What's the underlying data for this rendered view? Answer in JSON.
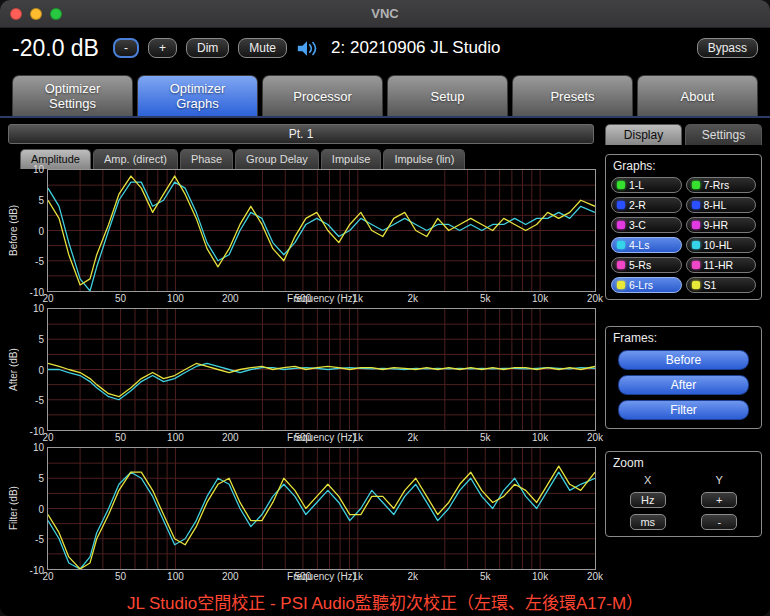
{
  "window": {
    "title": "VNC"
  },
  "toolbar": {
    "volume": "-20.0 dB",
    "volume_down": "-",
    "volume_up": "+",
    "dim": "Dim",
    "mute": "Mute",
    "source": "2: 20210906 JL Studio",
    "bypass": "Bypass"
  },
  "main_tabs": [
    {
      "label": "Optimizer\nSettings",
      "selected": false
    },
    {
      "label": "Optimizer\nGraphs",
      "selected": true
    },
    {
      "label": "Processor",
      "selected": false
    },
    {
      "label": "Setup",
      "selected": false
    },
    {
      "label": "Presets",
      "selected": false
    },
    {
      "label": "About",
      "selected": false
    }
  ],
  "graphs_panel": {
    "header": "Pt. 1",
    "sub_tabs": [
      {
        "label": "Amplitude",
        "selected": true
      },
      {
        "label": "Amp. (direct)",
        "selected": false
      },
      {
        "label": "Phase",
        "selected": false
      },
      {
        "label": "Group Delay",
        "selected": false
      },
      {
        "label": "Impulse",
        "selected": false
      },
      {
        "label": "Impulse (lin)",
        "selected": false
      }
    ]
  },
  "sidebar": {
    "tabs": [
      {
        "label": "Display",
        "selected": true
      },
      {
        "label": "Settings",
        "selected": false
      }
    ],
    "graphs_group_label": "Graphs:",
    "channels": [
      {
        "label": "1-L",
        "led": "#35e02f",
        "selected": false
      },
      {
        "label": "2-R",
        "led": "#2b50ff",
        "selected": false
      },
      {
        "label": "3-C",
        "led": "#e23ae2",
        "selected": false
      },
      {
        "label": "4-Ls",
        "led": "#35d4e8",
        "selected": true
      },
      {
        "label": "5-Rs",
        "led": "#f046c8",
        "selected": false
      },
      {
        "label": "6-Lrs",
        "led": "#e8e838",
        "selected": true
      },
      {
        "label": "7-Rrs",
        "led": "#35e02f",
        "selected": false
      },
      {
        "label": "8-HL",
        "led": "#2b50ff",
        "selected": false
      },
      {
        "label": "9-HR",
        "led": "#e23ae2",
        "selected": false
      },
      {
        "label": "10-HL",
        "led": "#35d4e8",
        "selected": false
      },
      {
        "label": "11-HR",
        "led": "#f046c8",
        "selected": false
      },
      {
        "label": "S1",
        "led": "#e8e838",
        "selected": false
      }
    ],
    "frames_group_label": "Frames:",
    "frame_buttons": [
      "Before",
      "After",
      "Filter"
    ],
    "zoom_group_label": "Zoom",
    "zoom_x_label": "X",
    "zoom_y_label": "Y",
    "zoom_x_buttons": [
      "Hz",
      "ms"
    ],
    "zoom_y_buttons": [
      "+",
      "-"
    ]
  },
  "status_bar": {
    "text": "JL Studio空間校正 - PSI Audio監聽初次校正（左環、左後環A17-M）"
  },
  "colors": {
    "accent": "#2f62d9",
    "trace_cyan": "#3fd0e0",
    "trace_yellow": "#e6e23c",
    "grid": "#4d1f1f",
    "status_text": "#ff4633"
  },
  "chart_data": [
    {
      "type": "line",
      "ylabel": "Before (dB)",
      "xlabel": "Frequency (Hz)",
      "xscale": "log",
      "xlim": [
        20,
        20000
      ],
      "ylim": [
        -10,
        10
      ],
      "x_ticks": [
        {
          "value": 20,
          "label": "20"
        },
        {
          "value": 50,
          "label": "50"
        },
        {
          "value": 100,
          "label": "100"
        },
        {
          "value": 200,
          "label": "200"
        },
        {
          "value": 500,
          "label": "500"
        },
        {
          "value": 1000,
          "label": "1k"
        },
        {
          "value": 2000,
          "label": "2k"
        },
        {
          "value": 5000,
          "label": "5k"
        },
        {
          "value": 10000,
          "label": "10k"
        },
        {
          "value": 20000,
          "label": "20k"
        }
      ],
      "y_ticks": [
        10,
        5,
        0,
        -5,
        -10
      ],
      "x_hz": [
        20,
        23,
        26,
        30,
        34,
        37,
        43,
        49,
        57,
        65,
        75,
        86,
        99,
        113,
        130,
        149,
        171,
        197,
        226,
        259,
        298,
        342,
        393,
        452,
        519,
        596,
        685,
        787,
        904,
        1039,
        1193,
        1371,
        1575,
        1810,
        2079,
        2389,
        2745,
        3154,
        3624,
        4164,
        4784,
        5497,
        6316,
        7257,
        8338,
        9580,
        11007,
        12647,
        14531,
        16697,
        20000
      ],
      "series": [
        {
          "name": "4-Ls",
          "color_key": "trace_cyan",
          "db": [
            7,
            4,
            -2,
            -8,
            -10,
            -6,
            0,
            5,
            8,
            8,
            4,
            5,
            8,
            7,
            3,
            -2,
            -5,
            -4,
            0,
            3,
            2,
            -2,
            -4,
            -2,
            1,
            2,
            1,
            -1,
            0,
            2,
            1,
            0,
            1,
            2,
            1,
            0,
            1,
            1,
            0,
            1,
            0,
            1,
            1,
            2,
            1,
            2,
            2,
            3,
            2,
            4,
            3
          ]
        },
        {
          "name": "6-Lrs",
          "color_key": "trace_yellow",
          "db": [
            5,
            2,
            -4,
            -9,
            -8,
            -4,
            1,
            6,
            9,
            7,
            3,
            6,
            9,
            6,
            2,
            -3,
            -6,
            -3,
            1,
            4,
            1,
            -3,
            -5,
            -1,
            2,
            3,
            0,
            -2,
            1,
            3,
            0,
            -1,
            2,
            3,
            0,
            -1,
            2,
            0,
            1,
            2,
            1,
            0,
            2,
            1,
            0,
            1,
            3,
            2,
            3,
            5,
            4
          ]
        }
      ]
    },
    {
      "type": "line",
      "ylabel": "After (dB)",
      "xlabel": "Frequency (Hz)",
      "xscale": "log",
      "xlim": [
        20,
        20000
      ],
      "ylim": [
        -10,
        10
      ],
      "x_ticks": [
        {
          "value": 20,
          "label": "20"
        },
        {
          "value": 50,
          "label": "50"
        },
        {
          "value": 100,
          "label": "100"
        },
        {
          "value": 200,
          "label": "200"
        },
        {
          "value": 500,
          "label": "500"
        },
        {
          "value": 1000,
          "label": "1k"
        },
        {
          "value": 2000,
          "label": "2k"
        },
        {
          "value": 5000,
          "label": "5k"
        },
        {
          "value": 10000,
          "label": "10k"
        },
        {
          "value": 20000,
          "label": "20k"
        }
      ],
      "y_ticks": [
        10,
        5,
        0,
        -5,
        -10
      ],
      "x_hz": [
        20,
        23,
        26,
        30,
        34,
        37,
        43,
        49,
        57,
        65,
        75,
        86,
        99,
        113,
        130,
        149,
        171,
        197,
        226,
        259,
        298,
        342,
        393,
        452,
        519,
        596,
        685,
        787,
        904,
        1039,
        1193,
        1371,
        1575,
        1810,
        2079,
        2389,
        2745,
        3154,
        3624,
        4164,
        4784,
        5497,
        6316,
        7257,
        8338,
        9580,
        11007,
        12647,
        14531,
        16697,
        20000
      ],
      "series": [
        {
          "name": "4-Ls",
          "color_key": "trace_cyan",
          "db": [
            0,
            0,
            -0.5,
            -1,
            -2,
            -3,
            -4.5,
            -5,
            -3.5,
            -2,
            -1,
            -2,
            -1.5,
            -0.5,
            0.5,
            1,
            0.5,
            0,
            -0.5,
            0,
            0.3,
            0.3,
            0,
            0.2,
            0.3,
            0.2,
            0,
            0.2,
            0.3,
            0.2,
            0.1,
            0.2,
            0.1,
            0,
            0.2,
            0.1,
            0.2,
            0.1,
            0.2,
            0.1,
            0.2,
            0.1,
            0.2,
            0.2,
            0.1,
            0.2,
            0.3,
            0.2,
            0.1,
            0.3,
            0.2
          ]
        },
        {
          "name": "6-Lrs",
          "color_key": "trace_yellow",
          "db": [
            1,
            0.5,
            0,
            -0.5,
            -1.5,
            -2.5,
            -4,
            -4.5,
            -3,
            -1.5,
            -0.5,
            -1.5,
            -1,
            0,
            1,
            0.5,
            0,
            -0.5,
            0,
            0.3,
            0.5,
            0,
            0.3,
            0.5,
            0,
            0.3,
            0.5,
            0.3,
            0,
            0.3,
            0.3,
            0,
            0.3,
            0.2,
            0,
            0.3,
            0,
            0.3,
            0,
            0.3,
            0,
            0.3,
            0,
            0.3,
            0.3,
            0,
            0.3,
            0,
            0.3,
            0,
            0.5
          ]
        }
      ]
    },
    {
      "type": "line",
      "ylabel": "Filter (dB)",
      "xlabel": "Frequency (Hz)",
      "xscale": "log",
      "xlim": [
        20,
        20000
      ],
      "ylim": [
        -10,
        10
      ],
      "x_ticks": [
        {
          "value": 20,
          "label": "20"
        },
        {
          "value": 50,
          "label": "50"
        },
        {
          "value": 100,
          "label": "100"
        },
        {
          "value": 200,
          "label": "200"
        },
        {
          "value": 500,
          "label": "500"
        },
        {
          "value": 1000,
          "label": "1k"
        },
        {
          "value": 2000,
          "label": "2k"
        },
        {
          "value": 5000,
          "label": "5k"
        },
        {
          "value": 10000,
          "label": "10k"
        },
        {
          "value": 20000,
          "label": "20k"
        }
      ],
      "y_ticks": [
        10,
        5,
        0,
        -5,
        -10
      ],
      "x_hz": [
        20,
        23,
        26,
        30,
        34,
        37,
        43,
        49,
        57,
        65,
        75,
        86,
        99,
        113,
        130,
        149,
        171,
        197,
        226,
        259,
        298,
        342,
        393,
        452,
        519,
        596,
        685,
        787,
        904,
        1039,
        1193,
        1371,
        1575,
        1810,
        2079,
        2389,
        2745,
        3154,
        3624,
        4164,
        4784,
        5497,
        6316,
        7257,
        8338,
        9580,
        11007,
        12647,
        14531,
        16697,
        20000
      ],
      "series": [
        {
          "name": "4-Ls",
          "color_key": "trace_cyan",
          "db": [
            -2,
            -5,
            -9,
            -10,
            -8,
            -4,
            0,
            4,
            6,
            5,
            2,
            -2,
            -6,
            -5,
            -2,
            2,
            5,
            4,
            0,
            -3,
            -1,
            2,
            4,
            2,
            -1,
            1,
            3,
            1,
            -2,
            0,
            3,
            1,
            -1,
            2,
            4,
            1,
            -2,
            0,
            3,
            5,
            2,
            0,
            3,
            5,
            2,
            0,
            3,
            6,
            3,
            4,
            5
          ]
        },
        {
          "name": "6-Lrs",
          "color_key": "trace_yellow",
          "db": [
            -1,
            -4,
            -8,
            -10,
            -9,
            -5,
            -1,
            3,
            6,
            6,
            3,
            -1,
            -5,
            -6,
            -3,
            1,
            4,
            5,
            1,
            -2,
            -2,
            1,
            5,
            3,
            0,
            2,
            4,
            2,
            -1,
            -1,
            2,
            2,
            0,
            3,
            5,
            2,
            -1,
            1,
            4,
            6,
            3,
            1,
            2,
            4,
            3,
            1,
            4,
            7,
            4,
            3,
            6
          ]
        }
      ]
    }
  ]
}
